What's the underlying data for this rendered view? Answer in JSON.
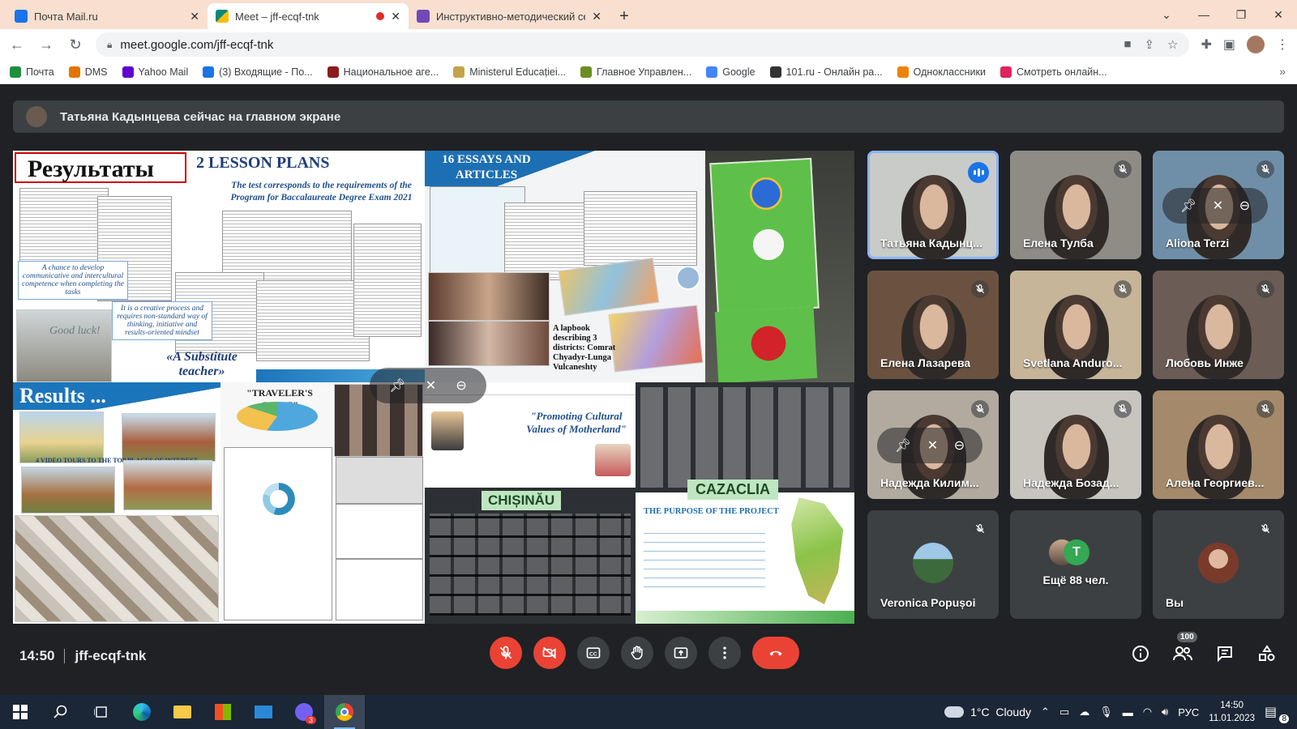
{
  "browser": {
    "tabs": [
      {
        "title": "Почта Mail.ru",
        "fav_color": "#1a73e8"
      },
      {
        "title": "Meet – jff-ecqf-tnk",
        "fav_color": "#00897b",
        "recording": true
      },
      {
        "title": "Инструктивно-методический се",
        "fav_color": "#7248b9"
      }
    ],
    "new_tab": "+",
    "address": "meet.google.com/jff-ecqf-tnk",
    "bookmarks": [
      {
        "label": "Почта",
        "color": "#1e8e3e"
      },
      {
        "label": "DMS",
        "color": "#e37400"
      },
      {
        "label": "Yahoo Mail",
        "color": "#5f01d1"
      },
      {
        "label": "(3) Входящие - По...",
        "color": "#1a73e8"
      },
      {
        "label": "Национальное аге...",
        "color": "#8b1c1c"
      },
      {
        "label": "Ministerul Educației...",
        "color": "#c2a44a"
      },
      {
        "label": "Главное Управлен...",
        "color": "#6b8e23"
      },
      {
        "label": "Google",
        "color": "#4285f4"
      },
      {
        "label": "101.ru - Онлайн ра...",
        "color": "#333333"
      },
      {
        "label": "Одноклассники",
        "color": "#ee8208"
      },
      {
        "label": "Смотреть онлайн...",
        "color": "#e0245e"
      }
    ],
    "bookmarks_more": "»"
  },
  "meet": {
    "presenting_notice": "Татьяна Кадынцева сейчас на главном экране",
    "slide": {
      "title_ru": "Результаты",
      "lesson_plans": "2 LESSON PLANS",
      "lesson_caption": "The test corresponds to the requirements of the Program for Baccalaureate Degree Exam 2021",
      "caption_chance": "A chance to develop communicative and intercultural competence when completing the tasks",
      "caption_creative": "It is a creative process and requires non-standard way of thinking, initiative and results-oriented mindset",
      "good_luck": "Good luck!",
      "substitute": "«A Substitute teacher»",
      "essays": "16 ESSAYS AND ARTICLES",
      "lapbook": "A lapbook describing 3 districts: Comrat Chyadyr-Lunga Vulcaneshty",
      "results": "Results ...",
      "video_tours": "4 VIDEO TOURS TO THE TOP PLACES OF INTEREST",
      "travelers_guide": "\"TRAVELER'S GUIDE\"",
      "promoting": "\"Promoting Cultural Values of Motherland\"",
      "chisinau": "CHIȘINĂU",
      "cazaclia": "CAZACLIA",
      "purpose": "THE PURPOSE OF THE PROJECT"
    },
    "participants": [
      {
        "name": "Татьяна Кадынц...",
        "speaking": true,
        "bg": "#c9cbc8"
      },
      {
        "name": "Елена Тулба",
        "muted": true,
        "bg": "#8f8c86"
      },
      {
        "name": "Aliona Terzi",
        "muted": true,
        "bg": "#6f8fa8"
      },
      {
        "name": "Елена Лазарева",
        "muted": true,
        "bg": "#6b5240"
      },
      {
        "name": "Svetlana Anduro...",
        "muted": true,
        "bg": "#c7b59a"
      },
      {
        "name": "Любовь Инже",
        "muted": true,
        "bg": "#6b5d55"
      },
      {
        "name": "Надежда Килим...",
        "muted": true,
        "bg": "#b2aa9f"
      },
      {
        "name": "Надежда Бозад...",
        "muted": true,
        "bg": "#c8c5bf"
      },
      {
        "name": "Алена Георгиев...",
        "muted": true,
        "bg": "#a48a6a"
      },
      {
        "name": "Veronica Popușoi",
        "muted": true,
        "bg": "#3c4043"
      },
      {
        "name": "Ещё 88 чел.",
        "bg": "#3c4043",
        "avatar_letter": "T"
      },
      {
        "name": "Вы",
        "muted": true,
        "bg": "#3c4043"
      }
    ],
    "time": "14:50",
    "meeting_code": "jff-ecqf-tnk",
    "participant_count": "100"
  },
  "taskbar": {
    "weather": "1°C  Cloudy",
    "lang": "РУС",
    "time": "14:50",
    "date": "11.01.2023",
    "notif_count": "8",
    "viber_badge": "3"
  },
  "colors": {
    "meet_bg": "#202124",
    "end_call": "#ea4335",
    "accent": "#8ab4f8",
    "tab_strip": "#f8dfcf"
  }
}
